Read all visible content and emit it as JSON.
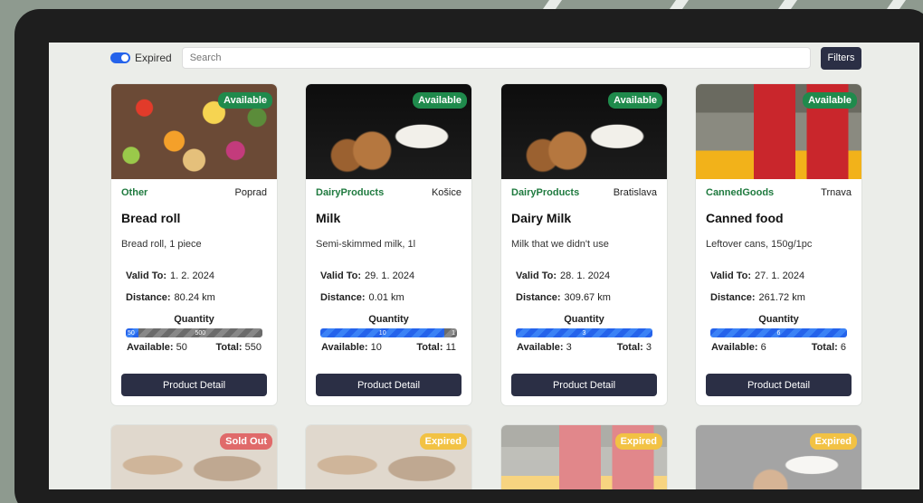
{
  "header": {
    "expired_toggle_label": "Expired",
    "search_placeholder": "Search",
    "filters_label": "Filters"
  },
  "colors": {
    "accent_blue": "#2563eb",
    "dark_button": "#2b2f45",
    "available_green": "#1f8a4c",
    "sold_out_red": "#e06a6a",
    "expired_yellow": "#f2c244"
  },
  "labels": {
    "valid_to": "Valid To:",
    "distance": "Distance:",
    "quantity": "Quantity",
    "available": "Available:",
    "total": "Total:",
    "detail_button": "Product Detail"
  },
  "products": [
    {
      "status": "Available",
      "category": "Other",
      "location": "Poprad",
      "title": "Bread roll",
      "description": "Bread roll, 1 piece",
      "valid_to": "1. 2. 2024",
      "distance": "80.24 km",
      "available": 50,
      "total": 550,
      "bar_available_text": "50",
      "bar_used_text": "500",
      "image": "mixed-food-image"
    },
    {
      "status": "Available",
      "category": "DairyProducts",
      "location": "Košice",
      "title": "Milk",
      "description": "Semi-skimmed milk, 1l",
      "valid_to": "29. 1. 2024",
      "distance": "0.01 km",
      "available": 10,
      "total": 11,
      "bar_available_text": "10",
      "bar_used_text": "1",
      "image": "milk-cookies-image"
    },
    {
      "status": "Available",
      "category": "DairyProducts",
      "location": "Bratislava",
      "title": "Dairy Milk",
      "description": "Milk that we didn't use",
      "valid_to": "28. 1. 2024",
      "distance": "309.67 km",
      "available": 3,
      "total": 3,
      "bar_available_text": "3",
      "bar_used_text": "",
      "image": "milk-cookies-image"
    },
    {
      "status": "Available",
      "category": "CannedGoods",
      "location": "Trnava",
      "title": "Canned food",
      "description": "Leftover cans, 150g/1pc",
      "valid_to": "27. 1. 2024",
      "distance": "261.72 km",
      "available": 6,
      "total": 6,
      "bar_available_text": "6",
      "bar_used_text": "",
      "image": "canned-soup-image"
    }
  ],
  "second_row": [
    {
      "status": "Sold Out",
      "image": "bread-image"
    },
    {
      "status": "Expired",
      "image": "bread-image"
    },
    {
      "status": "Expired",
      "image": "canned-soup-image"
    },
    {
      "status": "Expired",
      "image": "milk-cookies-image"
    }
  ]
}
